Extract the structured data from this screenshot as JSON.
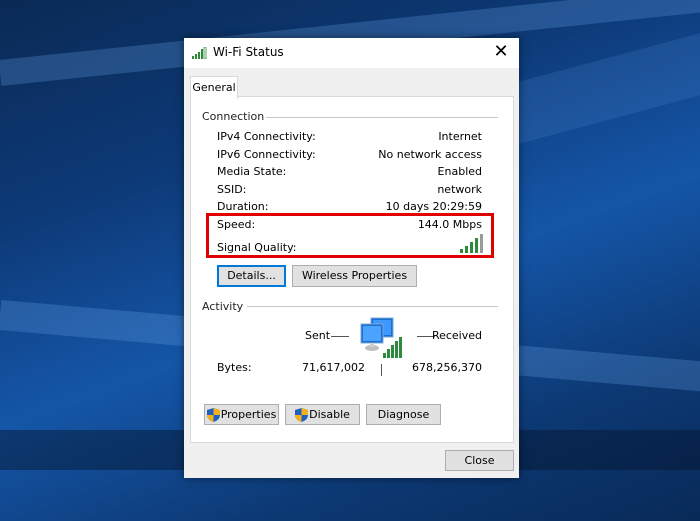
{
  "window": {
    "title": "Wi-Fi Status",
    "close_glyph": "✕"
  },
  "tabs": [
    {
      "label": "General",
      "active": true
    }
  ],
  "connection": {
    "group_label": "Connection",
    "rows": [
      {
        "label": "IPv4 Connectivity:",
        "value": "Internet"
      },
      {
        "label": "IPv6 Connectivity:",
        "value": "No network access"
      },
      {
        "label": "Media State:",
        "value": "Enabled"
      },
      {
        "label": "SSID:",
        "value": "network"
      },
      {
        "label": "Duration:",
        "value": "10 days 20:29:59"
      },
      {
        "label": "Speed:",
        "value": "144.0 Mbps"
      },
      {
        "label": "Signal Quality:",
        "value_icon": "signal-bars-icon",
        "bars_filled": 4,
        "bars_total": 5
      }
    ],
    "buttons": {
      "details": "Details...",
      "wireless_properties": "Wireless Properties"
    }
  },
  "activity": {
    "group_label": "Activity",
    "sent_label": "Sent",
    "received_label": "Received",
    "bytes_label": "Bytes:",
    "bytes_sent": "71,617,002",
    "bytes_received": "678,256,370",
    "icon": "network-computers-icon"
  },
  "actions": {
    "properties": "Properties",
    "disable": "Disable",
    "diagnose": "Diagnose"
  },
  "footer": {
    "close": "Close"
  },
  "colors": {
    "highlight": "#e00000",
    "signal": "#2e8b3e",
    "default_button_border": "#0078d7"
  }
}
